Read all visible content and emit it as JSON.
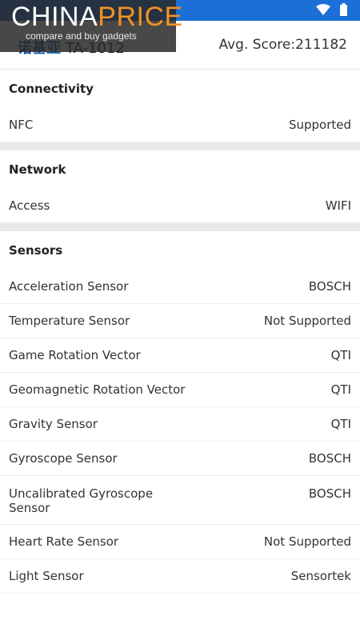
{
  "watermark": {
    "logo_part1": "CHINA",
    "logo_part2": "PRICE",
    "tagline": "compare and buy gadgets"
  },
  "header": {
    "brand": "诺基亚",
    "model": "TA-1012",
    "avg_score": "Avg. Score:211182"
  },
  "sections": [
    {
      "title": "Connectivity",
      "rows": [
        {
          "label": "NFC",
          "value": "Supported"
        }
      ]
    },
    {
      "title": "Network",
      "rows": [
        {
          "label": "Access",
          "value": "WIFI"
        }
      ]
    },
    {
      "title": "Sensors",
      "rows": [
        {
          "label": "Acceleration Sensor",
          "value": "BOSCH"
        },
        {
          "label": "Temperature Sensor",
          "value": "Not Supported"
        },
        {
          "label": "Game Rotation Vector",
          "value": "QTI"
        },
        {
          "label": "Geomagnetic Rotation Vector",
          "value": "QTI"
        },
        {
          "label": "Gravity Sensor",
          "value": "QTI"
        },
        {
          "label": "Gyroscope Sensor",
          "value": "BOSCH"
        },
        {
          "label": "Uncalibrated Gyroscope Sensor",
          "value": "BOSCH"
        },
        {
          "label": "Heart Rate Sensor",
          "value": "Not Supported"
        },
        {
          "label": "Light Sensor",
          "value": "Sensortek"
        }
      ]
    }
  ],
  "colors": {
    "statusbar": "#1b6fd6",
    "watermark_accent": "#f29222"
  },
  "icons": [
    "wifi-icon",
    "battery-icon"
  ]
}
